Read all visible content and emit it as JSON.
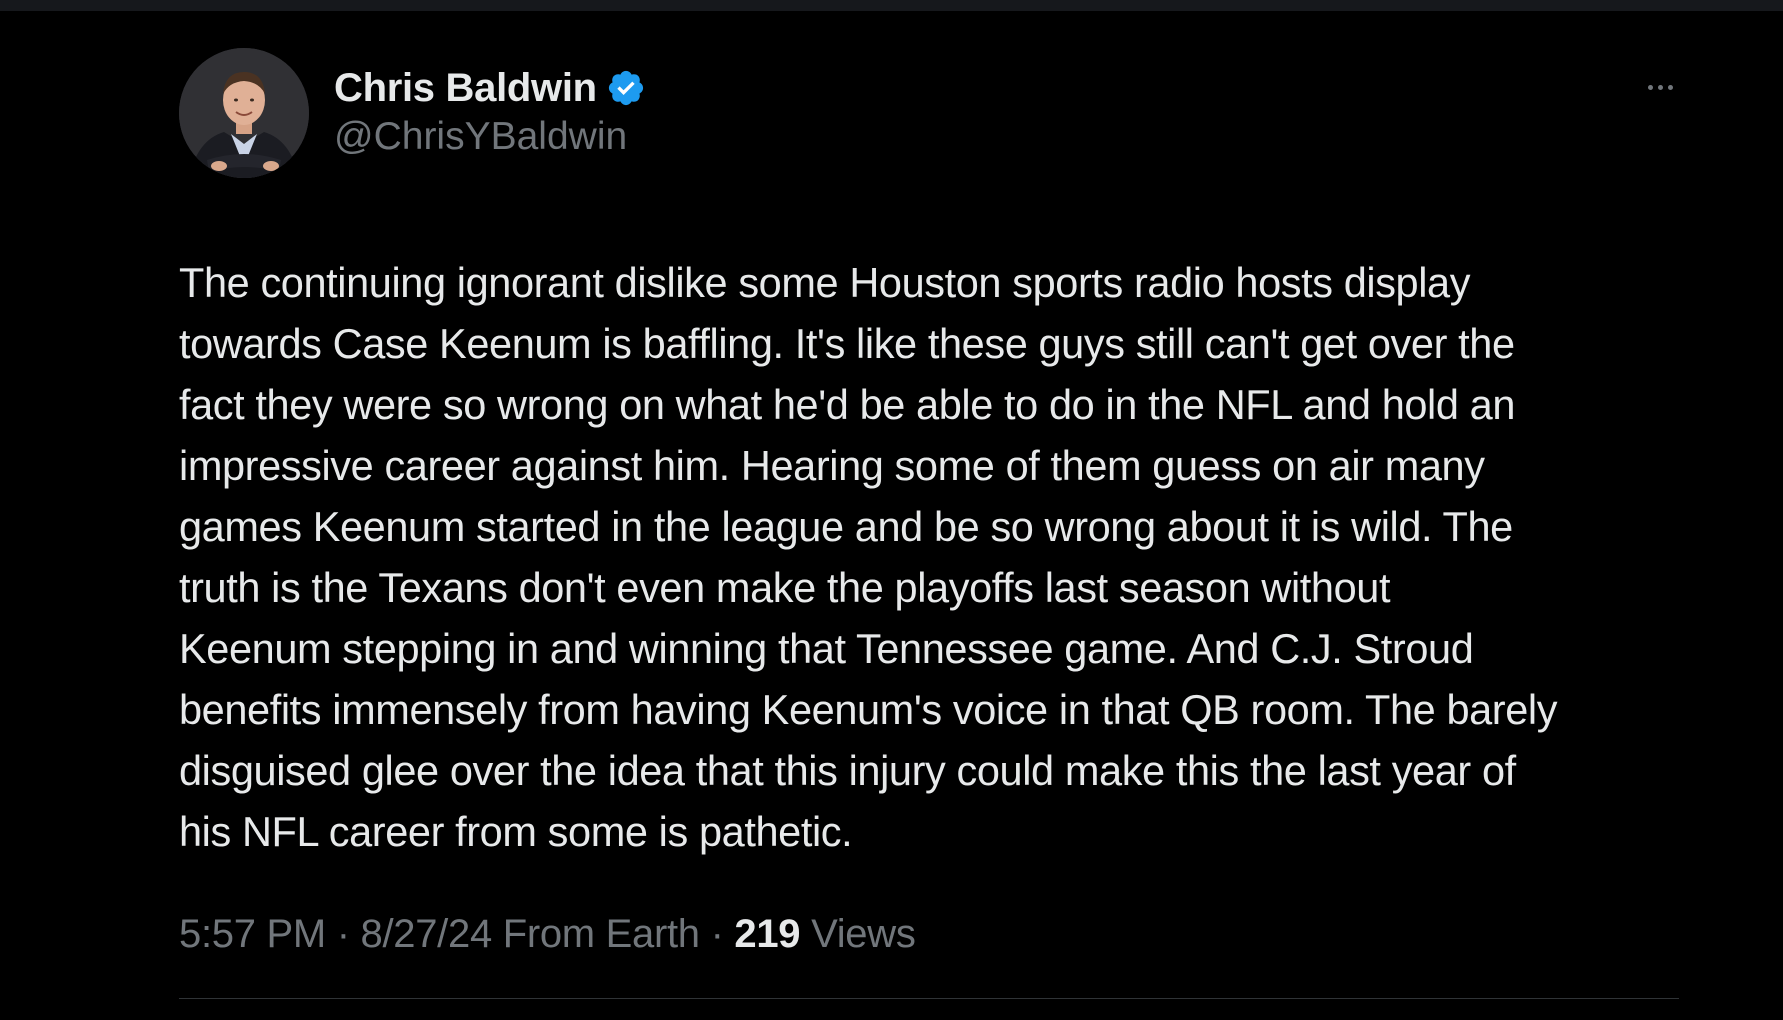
{
  "author": {
    "display_name": "Chris Baldwin",
    "handle": "@ChrisYBaldwin",
    "verified": true,
    "verified_badge_color": "#1d9bf0"
  },
  "tweet": {
    "text_lines": [
      "The continuing ignorant dislike some Houston sports radio hosts display",
      "towards Case Keenum is baffling. It's like these guys still can't get over the",
      "fact they were so wrong on what he'd be able to do in the NFL and hold an",
      "impressive career against him. Hearing some of them guess on air many",
      "games Keenum started in the league and be so wrong about it is wild. The",
      "truth is the Texans don't even make the playoffs last season without",
      "Keenum stepping in and winning that Tennessee game. And C.J. Stroud",
      "benefits immensely from having Keenum's voice in that QB room. The barely",
      "disguised glee over the idea that this injury could make this the last year of",
      "his NFL career from some is pathetic."
    ]
  },
  "meta": {
    "time": "5:57 PM",
    "separator": " · ",
    "date": "8/27/24",
    "location": " From Earth",
    "views_count": "219",
    "views_label": " Views"
  },
  "icons": {
    "more": "more-horizontal-icon",
    "verified": "verified-badge-icon"
  },
  "colors": {
    "background": "#000000",
    "primary_text": "#e7e9ea",
    "secondary_text": "#71767b",
    "divider": "#2f3336"
  }
}
